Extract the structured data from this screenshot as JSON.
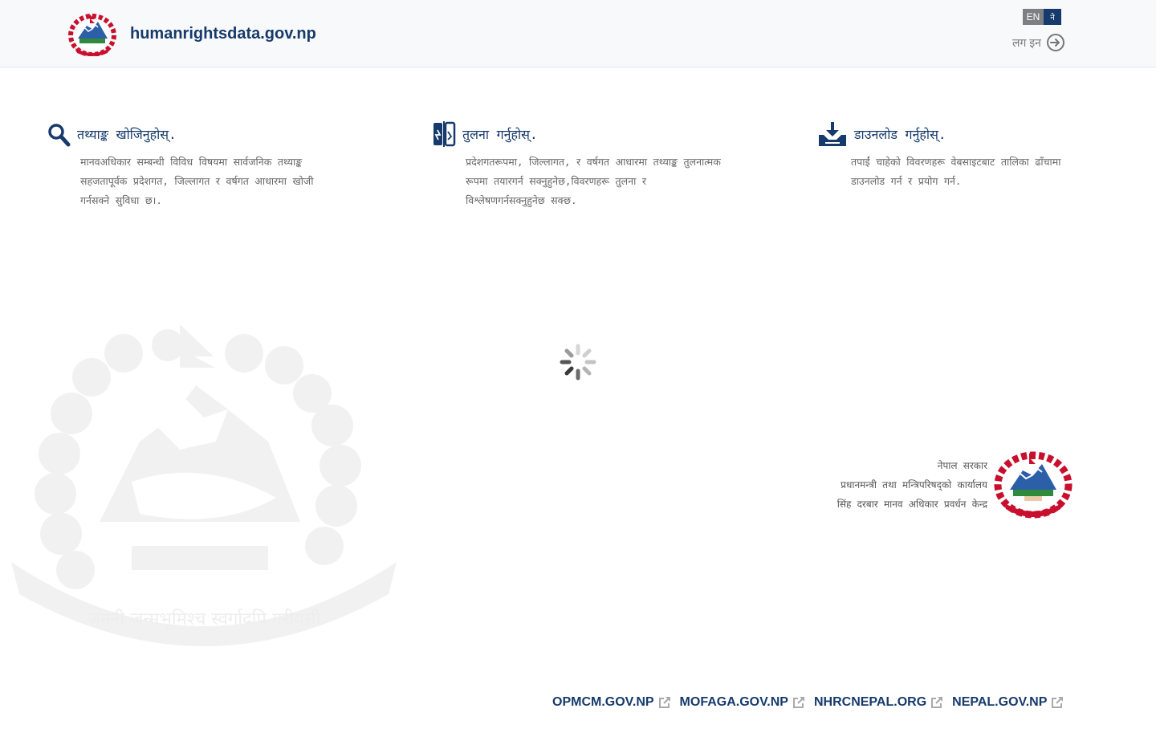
{
  "header": {
    "site_title": "humanrightsdata.gov.np",
    "lang_en": "EN",
    "lang_np": "ने",
    "login_label": "लग इन"
  },
  "features": [
    {
      "icon": "search-icon",
      "title": "तथ्याङ्क खोजिनुहोस्.",
      "description": "मानवअधिकार सम्बन्धी विविध विषयमा सार्वजनिक तथ्याङ्क सहजतापूर्वक प्रदेशगत, जिल्लागत र वर्षगत आधारमा खोजी गर्नसक्ने सुविधा छ।."
    },
    {
      "icon": "compare-icon",
      "title": "तुलना गर्नुहोस्.",
      "description": "प्रदेशगतरूपमा, जिल्लागत, र वर्षगत आधारमा तथ्याङ्क तुलनात्मक रूपमा तयारगर्न सक्नुहुनेछ,विवरणहरू तुलना र विश्लेषणगर्नसक्नुहुनेछ सक्छ."
    },
    {
      "icon": "download-icon",
      "title": "डाउनलोड गर्नुहोस्.",
      "description": "तपाईं चाहेको विवरणहरू वेबसाइटबाट तालिका ढाँचामा डाउनलोड गर्न र प्रयोग गर्न."
    }
  ],
  "gov_info": {
    "line1": "नेपाल सरकार",
    "line2": "प्रधानमन्त्री तथा मन्त्रिपरिषद्को कार्यालय",
    "line3": "सिंह दरबार मानव अधिकार प्रवर्धन केन्द्र"
  },
  "footer_links": [
    {
      "label": "OPMCM.GOV.NP"
    },
    {
      "label": "MOFAGA.GOV.NP"
    },
    {
      "label": "NHRCNEPAL.ORG"
    },
    {
      "label": "NEPAL.GOV.NP"
    }
  ],
  "colors": {
    "brand_navy": "#163a6b",
    "header_bg": "#f8f9fa",
    "lang_en_bg": "#7d7f82"
  },
  "watermark_motto": "जननी जन्मभूमिश्च स्वर्गादपि गरीयसी"
}
